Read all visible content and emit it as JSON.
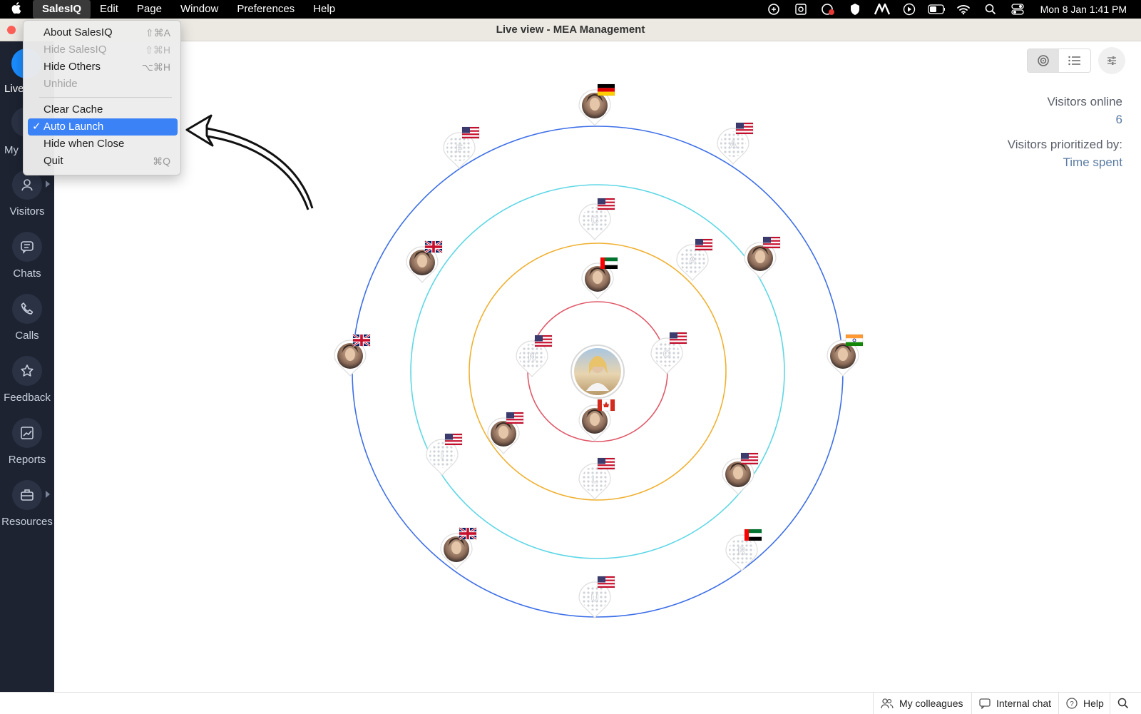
{
  "menubar": {
    "app": "SalesIQ",
    "items": [
      "Edit",
      "Page",
      "Window",
      "Preferences",
      "Help"
    ],
    "clock": "Mon 8 Jan  1:41 PM"
  },
  "window": {
    "title": "Live view - MEA Management"
  },
  "dropdown": {
    "items": [
      {
        "label": "About SalesIQ",
        "shortcut": "⇧⌘A",
        "disabled": false
      },
      {
        "label": "Hide SalesIQ",
        "shortcut": "⇧⌘H",
        "disabled": true
      },
      {
        "label": "Hide Others",
        "shortcut": "⌥⌘H",
        "disabled": false
      },
      {
        "label": "Unhide",
        "shortcut": "",
        "disabled": true
      },
      {
        "label": "Clear Cache",
        "shortcut": "",
        "disabled": false
      },
      {
        "label": "Auto Launch",
        "shortcut": "",
        "disabled": false,
        "checked": true
      },
      {
        "label": "Hide when Close",
        "shortcut": "",
        "disabled": false
      },
      {
        "label": "Quit",
        "shortcut": "⌘Q",
        "disabled": false
      }
    ]
  },
  "sidebar": {
    "live_label": "Live",
    "my_label": "My",
    "items": [
      {
        "label": "Visitors",
        "icon": "user-icon"
      },
      {
        "label": "Chats",
        "icon": "chat-icon"
      },
      {
        "label": "Calls",
        "icon": "phone-icon"
      },
      {
        "label": "Feedback",
        "icon": "star-icon"
      },
      {
        "label": "Reports",
        "icon": "chart-icon"
      },
      {
        "label": "Resources",
        "icon": "briefcase-icon"
      }
    ]
  },
  "stats": {
    "online_label": "Visitors online",
    "online_value": "6",
    "priority_label": "Visitors prioritized by:",
    "priority_value": "Time spent"
  },
  "visitors": [
    {
      "initial": "N",
      "flag": "us",
      "photo": false
    },
    {
      "initial": "C",
      "flag": "us",
      "photo": false
    },
    {
      "initial": "",
      "flag": "ca",
      "photo": true
    },
    {
      "initial": "",
      "flag": "ae",
      "photo": true
    },
    {
      "initial": "A",
      "flag": "us",
      "photo": false
    },
    {
      "initial": "",
      "flag": "us",
      "photo": true
    },
    {
      "initial": "L",
      "flag": "us",
      "photo": false
    },
    {
      "initial": "C",
      "flag": "us",
      "photo": false
    },
    {
      "initial": "",
      "flag": "gb",
      "photo": true
    },
    {
      "initial": "",
      "flag": "us",
      "photo": true
    },
    {
      "initial": "",
      "flag": "us",
      "photo": true
    },
    {
      "initial": "I",
      "flag": "us",
      "photo": false
    },
    {
      "initial": "",
      "flag": "de",
      "photo": true
    },
    {
      "initial": "A",
      "flag": "us",
      "photo": false
    },
    {
      "initial": "",
      "flag": "in",
      "photo": true
    },
    {
      "initial": "R",
      "flag": "ae",
      "photo": false
    },
    {
      "initial": "U",
      "flag": "us",
      "photo": false
    },
    {
      "initial": "",
      "flag": "gb",
      "photo": true
    },
    {
      "initial": "",
      "flag": "gb",
      "photo": true
    },
    {
      "initial": "F",
      "flag": "us",
      "photo": false
    }
  ],
  "statusbar": {
    "colleagues": "My colleagues",
    "internal_chat": "Internal chat",
    "help": "Help"
  },
  "colors": {
    "ring1": "#e05a6a",
    "ring2": "#f0b030",
    "ring3": "#5fd7e6",
    "ring4": "#3d6fe8",
    "accent": "#3b82f6",
    "sidebar": "#1d2331"
  }
}
